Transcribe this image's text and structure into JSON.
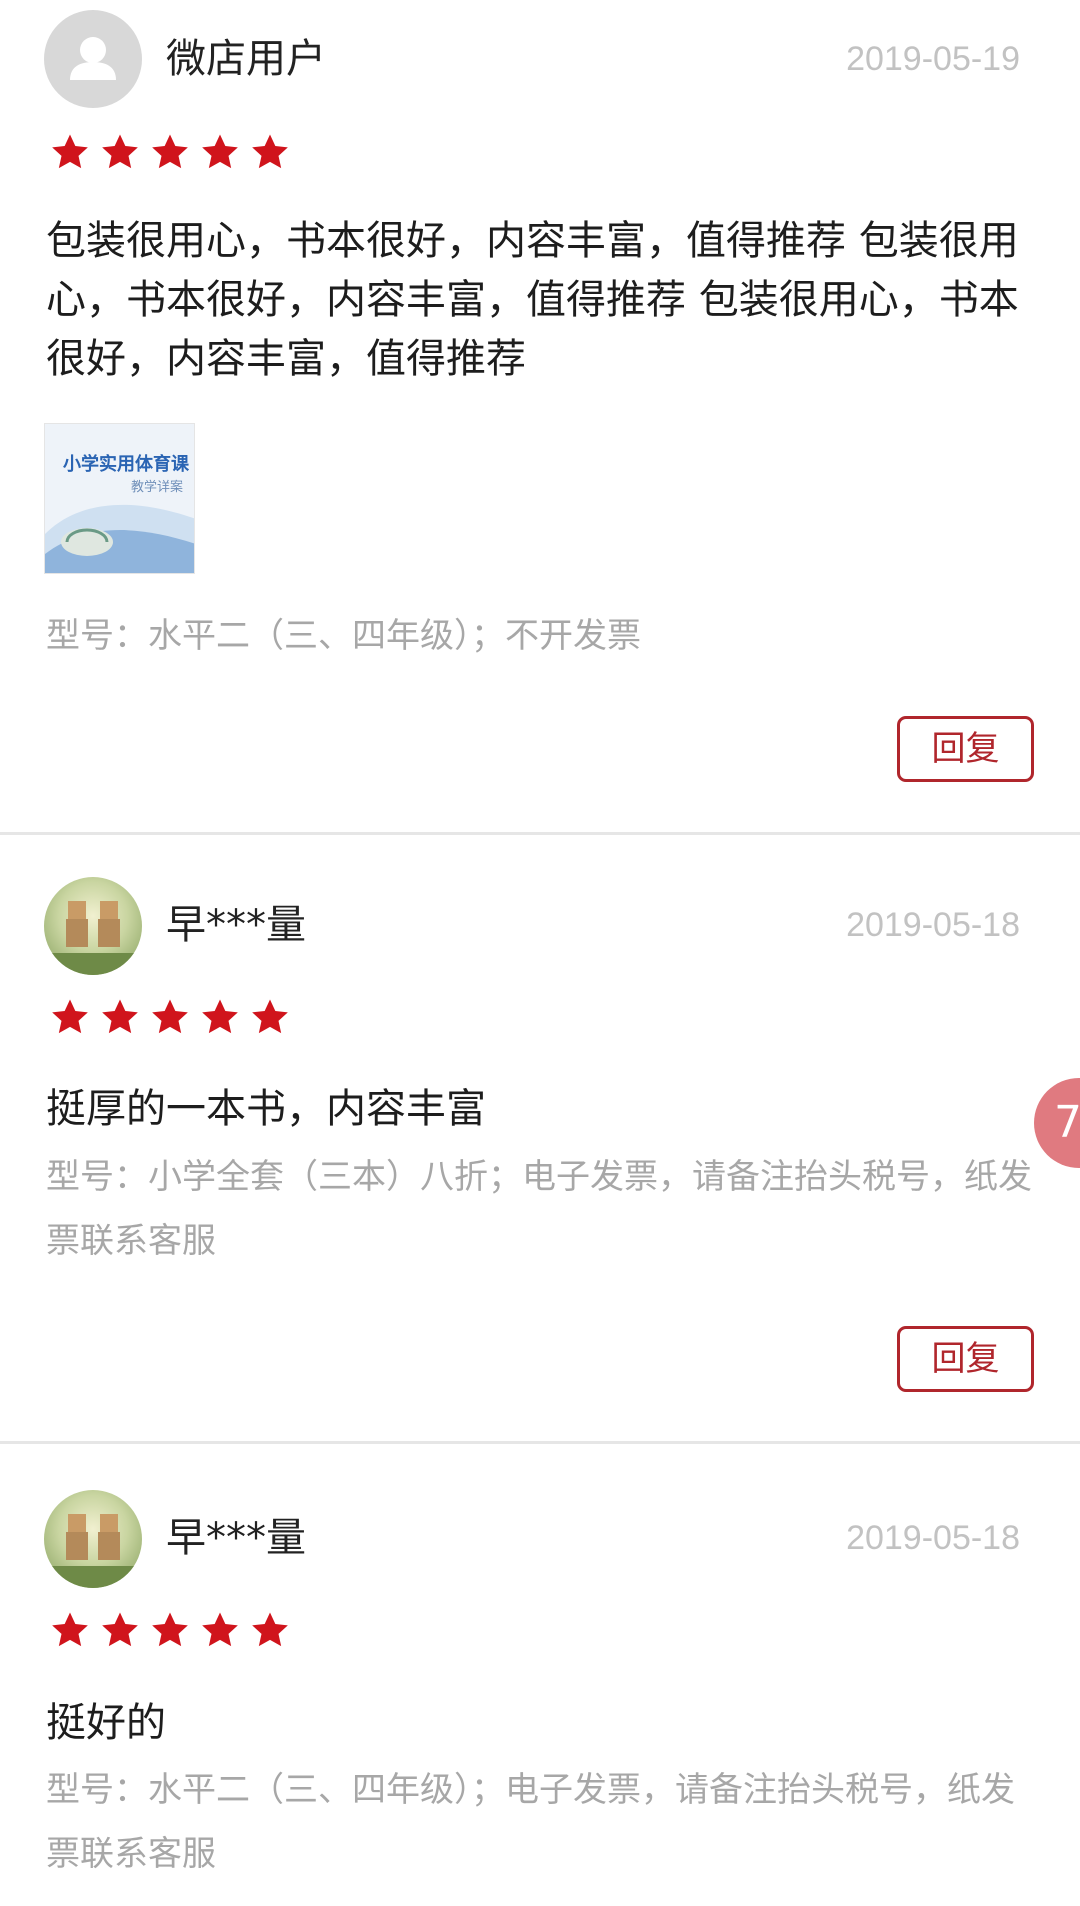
{
  "reviews": [
    {
      "username": "微店用户",
      "date": "2019-05-19",
      "rating": 5,
      "content": "包装很用心，书本很好，内容丰富，值得推荐 包装很用心，书本很好，内容丰富，值得推荐 包装很用心，书本很好，内容丰富，值得推荐",
      "image": {
        "title": "小学实用体育课",
        "subtitle": "教学详案"
      },
      "spec": "型号：水平二（三、四年级）；不开发票",
      "reply_label": "回复"
    },
    {
      "username": "早***量",
      "date": "2019-05-18",
      "rating": 5,
      "content": "挺厚的一本书，内容丰富",
      "spec": "型号：小学全套（三本）八折；电子发票，请备注抬头税号，纸发票联系客服",
      "reply_label": "回复"
    },
    {
      "username": "早***量",
      "date": "2019-05-18",
      "rating": 5,
      "content": "挺好的",
      "spec": "型号：水平二（三、四年级）；电子发票，请备注抬头税号，纸发票联系客服"
    }
  ],
  "floating_badge": "7",
  "colors": {
    "star": "#d0141c",
    "reply_border": "#b0262c",
    "muted_text": "#a7a7a7"
  },
  "icons": {
    "default_avatar": "user-silhouette-icon",
    "star": "star-icon"
  }
}
